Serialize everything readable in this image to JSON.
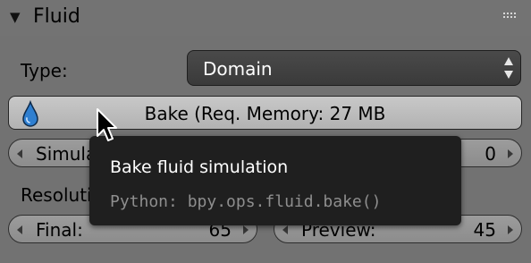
{
  "panel": {
    "title": "Fluid"
  },
  "type_row": {
    "label": "Type:",
    "value": "Domain"
  },
  "bake": {
    "label": "Bake (Req. Memory: 27 MB",
    "icon": "water-drop-icon"
  },
  "simulation_threads": {
    "label": "Simulation Threads:",
    "value": "0"
  },
  "resolution": {
    "label": "Resolution:",
    "final_label": "Final:",
    "final_value": "65",
    "preview_label": "Preview:",
    "preview_value": "45"
  },
  "tooltip": {
    "title": "Bake fluid simulation",
    "python": "Python: bpy.ops.fluid.bake()"
  },
  "colors": {
    "panel_bg": "#727272",
    "tooltip_bg": "#1f1f1f",
    "select_bg": "#424242",
    "accent_drop": "#2f7fd0"
  }
}
